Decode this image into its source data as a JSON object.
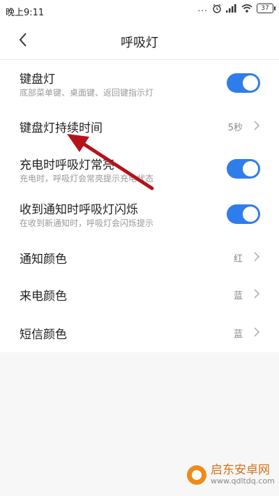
{
  "status_bar": {
    "time": "晚上9:11",
    "signal_dots": "...",
    "battery": "37"
  },
  "header": {
    "title": "呼吸灯"
  },
  "settings": [
    {
      "title": "键盘灯",
      "subtitle": "底部菜单键、桌面键、返回键指示灯",
      "toggle_on": true
    },
    {
      "title": "键盘灯持续时间",
      "value": "5秒"
    },
    {
      "title": "充电时呼吸灯常亮",
      "subtitle": "充电时，呼吸灯会常亮提示充电状态",
      "toggle_on": true
    },
    {
      "title": "收到通知时呼吸灯闪烁",
      "subtitle": "在收到新通知时，呼吸灯会闪烁提示",
      "toggle_on": true
    },
    {
      "title": "通知颜色",
      "value": "红"
    },
    {
      "title": "来电颜色",
      "value": "蓝"
    },
    {
      "title": "短信颜色",
      "value": "蓝"
    }
  ],
  "colors": {
    "accent": "#2f7dea",
    "annotation_arrow": "#b5121b",
    "watermark": "#f08a1c"
  },
  "watermark": {
    "name": "启东安卓网",
    "url": "www.qdltdq.com"
  }
}
